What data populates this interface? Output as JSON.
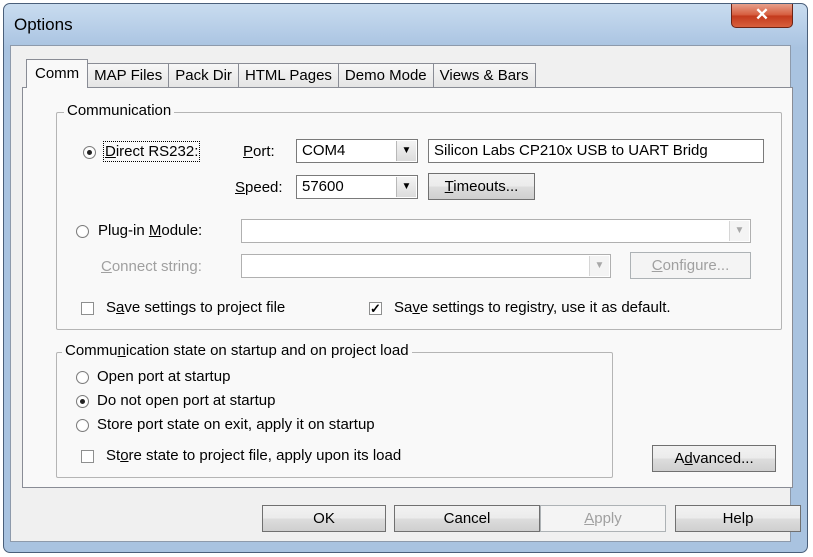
{
  "window": {
    "title": "Options",
    "close_glyph": "✕",
    "close_icon": "close-icon"
  },
  "tabs": [
    {
      "label": "Comm",
      "active": true
    },
    {
      "label": "MAP Files"
    },
    {
      "label": "Pack Dir"
    },
    {
      "label": "HTML Pages"
    },
    {
      "label": "Demo Mode"
    },
    {
      "label": "Views & Bars"
    }
  ],
  "communication": {
    "caption": "Communication",
    "direct_pre": "",
    "direct_u": "D",
    "direct_post": "irect RS232:",
    "direct_selected": true,
    "port_u": "P",
    "port_post": "ort:",
    "port_value": "COM4",
    "port_desc": "Silicon Labs CP210x USB to UART Bridg",
    "speed_u": "S",
    "speed_post": "peed:",
    "speed_value": "57600",
    "timeouts_u": "T",
    "timeouts_post": "imeouts...",
    "plugin_pre": "Plug-in ",
    "plugin_u": "M",
    "plugin_post": "odule:",
    "plugin_selected": false,
    "connect_u": "C",
    "connect_post": "onnect string:",
    "configure_u": "C",
    "configure_post": "onfigure...",
    "save_project_pre": "S",
    "save_project_u": "a",
    "save_project_post": "ve settings to project file",
    "save_project_checked": false,
    "save_registry_pre": "Sa",
    "save_registry_u": "v",
    "save_registry_post": "e settings to registry, use it as default.",
    "save_registry_checked": true,
    "check_glyph": "✓"
  },
  "startup": {
    "caption_pre": "Commu",
    "caption_u": "n",
    "caption_post": "ication state on startup and on project load",
    "options": [
      {
        "label": "Open port at startup",
        "selected": false
      },
      {
        "label": "Do not open port at startup",
        "selected": true
      },
      {
        "label": "Store port state on exit, apply it on startup",
        "selected": false
      }
    ],
    "store_pre": "St",
    "store_u": "o",
    "store_post": "re state to project file, apply upon its load",
    "store_checked": false
  },
  "advanced": {
    "pre": "A",
    "u": "d",
    "post": "vanced..."
  },
  "buttons": {
    "ok": "OK",
    "cancel": "Cancel",
    "apply_u": "A",
    "apply_post": "pply",
    "help": "Help"
  },
  "arrow_glyph": "▼"
}
